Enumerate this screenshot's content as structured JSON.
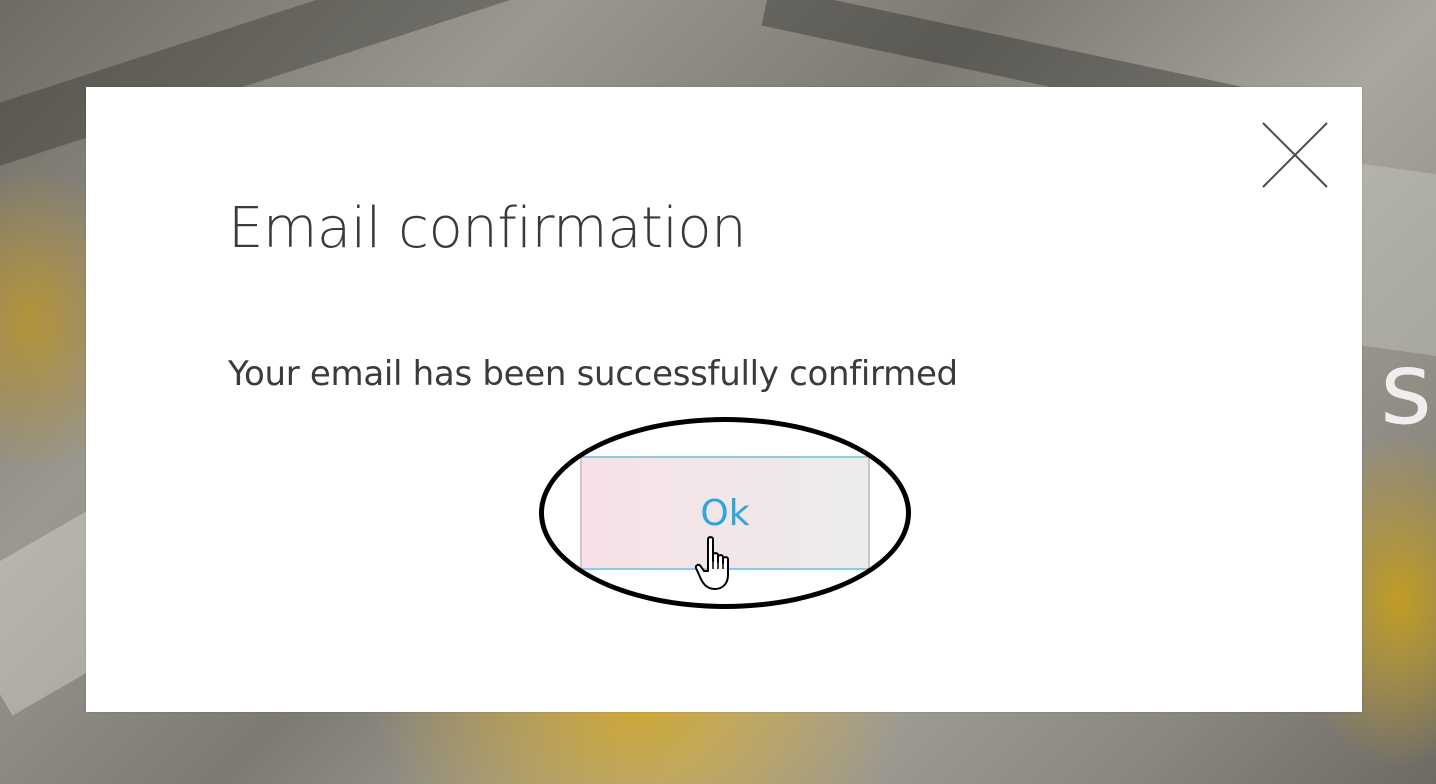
{
  "background": {
    "partial_text": "sf"
  },
  "modal": {
    "title": "Email confirmation",
    "message": "Your email has been successfully confirmed",
    "ok_label": "Ok",
    "close_icon": "close-icon"
  },
  "colors": {
    "ok_text": "#2ea6dc",
    "ok_border": "#8fc9e8",
    "title_text": "#3a3a3a",
    "highlight_ring": "#000000"
  },
  "annotation": {
    "highlight": "ellipse-around-ok-button",
    "cursor": "hand-pointer-cursor"
  }
}
